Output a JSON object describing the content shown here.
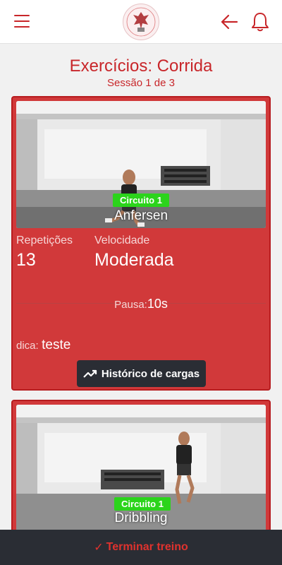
{
  "header": {
    "menu_icon": "hamburger-menu-icon",
    "back_icon": "arrow-left-icon",
    "bell_icon": "bell-icon"
  },
  "page": {
    "title": "Exercícios: Corrida",
    "session": "Sessão 1 de 3"
  },
  "exercises": [
    {
      "circuit": "Circuito 1",
      "name": "Anfersen",
      "repetitions_label": "Repetições",
      "repetitions": "13",
      "speed_label": "Velocidade",
      "speed": "Moderada",
      "pause_label": "Pausa:",
      "pause": "10s",
      "tip_label": "dica:",
      "tip": "teste",
      "history_button": "Histórico de cargas"
    },
    {
      "circuit": "Circuito 1",
      "name": "Dribbling"
    }
  ],
  "footer": {
    "check": "✓",
    "finish_label": "Terminar treino"
  },
  "colors": {
    "accent": "#c8262a",
    "card": "#d1393a",
    "badge": "#2bd41b",
    "dark": "#2a2d34"
  }
}
